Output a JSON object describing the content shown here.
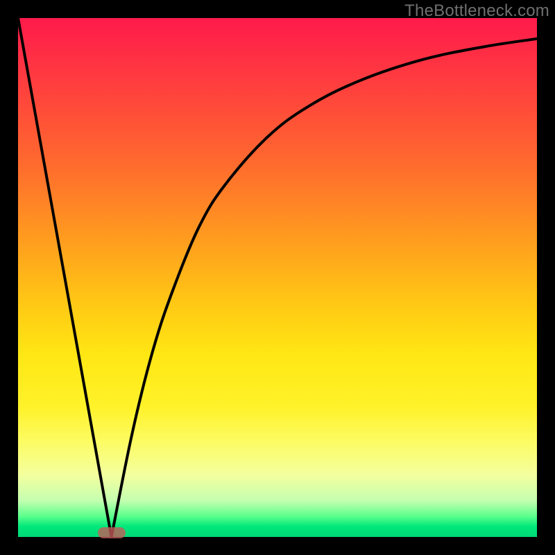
{
  "watermark": "TheBottleneck.com",
  "colors": {
    "frame": "#000000",
    "curve": "#000000",
    "marker": "#c65a5a"
  },
  "chart_data": {
    "type": "line",
    "title": "",
    "xlabel": "",
    "ylabel": "",
    "xlim": [
      0,
      100
    ],
    "ylim": [
      0,
      100
    ],
    "grid": false,
    "legend": false,
    "series": [
      {
        "name": "left-line",
        "x": [
          0,
          18
        ],
        "y": [
          100,
          0
        ]
      },
      {
        "name": "right-curve",
        "x": [
          18,
          22,
          26,
          30,
          35,
          40,
          48,
          56,
          66,
          78,
          90,
          100
        ],
        "y": [
          0,
          20,
          36,
          48,
          60,
          68,
          77,
          83,
          88,
          92,
          94.5,
          96
        ]
      }
    ],
    "marker": {
      "x": 18,
      "y": 0
    },
    "gradient_stops": [
      {
        "pct": 0,
        "color": "#ff1a4b"
      },
      {
        "pct": 12,
        "color": "#ff3c3f"
      },
      {
        "pct": 28,
        "color": "#ff6a2e"
      },
      {
        "pct": 42,
        "color": "#ff9a1f"
      },
      {
        "pct": 55,
        "color": "#ffc814"
      },
      {
        "pct": 65,
        "color": "#ffe714"
      },
      {
        "pct": 75,
        "color": "#fff22a"
      },
      {
        "pct": 82,
        "color": "#fcfc66"
      },
      {
        "pct": 88,
        "color": "#f4ff9e"
      },
      {
        "pct": 93,
        "color": "#c4ffb0"
      },
      {
        "pct": 96,
        "color": "#5cff8c"
      },
      {
        "pct": 98,
        "color": "#00e87a"
      },
      {
        "pct": 100,
        "color": "#00d877"
      }
    ]
  }
}
